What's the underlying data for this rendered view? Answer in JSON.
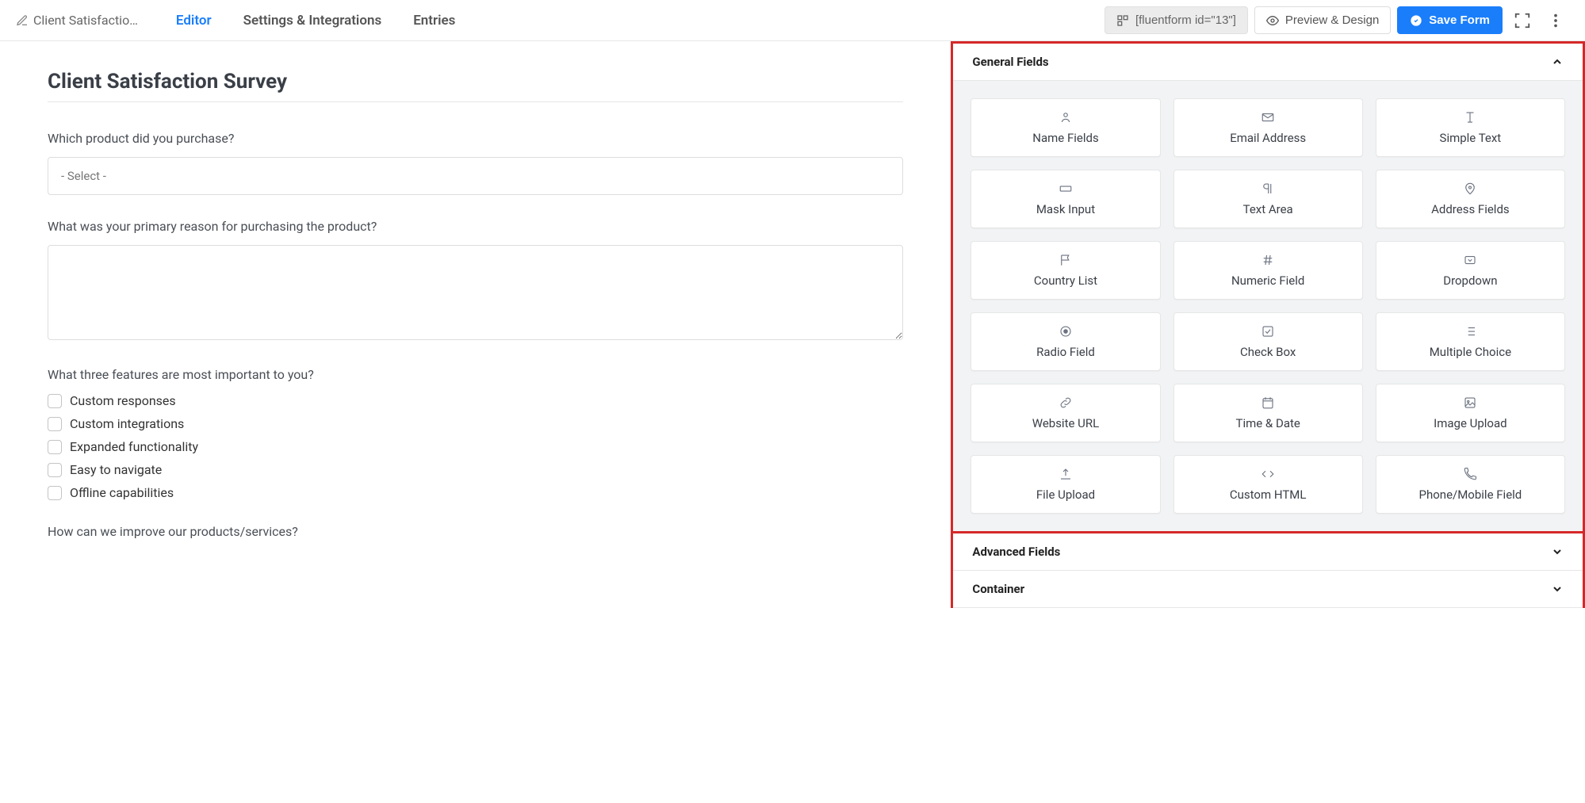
{
  "header": {
    "form_name": "Client Satisfactio…",
    "tabs": {
      "editor": "Editor",
      "settings": "Settings & Integrations",
      "entries": "Entries"
    },
    "shortcode": "[fluentform id=\"13\"]",
    "preview_label": "Preview & Design",
    "save_label": "Save Form"
  },
  "form": {
    "title": "Client Satisfaction Survey",
    "q1_label": "Which product did you purchase?",
    "q1_placeholder": "- Select -",
    "q2_label": "What was your primary reason for purchasing the product?",
    "q3_label": "What three features are most important to you?",
    "q3_options": [
      "Custom responses",
      "Custom integrations",
      "Expanded functionality",
      "Easy to navigate",
      "Offline capabilities"
    ],
    "q4_label": "How can we improve our products/services?"
  },
  "panels": {
    "general_title": "General Fields",
    "advanced_title": "Advanced Fields",
    "container_title": "Container",
    "general_fields": [
      "Name Fields",
      "Email Address",
      "Simple Text",
      "Mask Input",
      "Text Area",
      "Address Fields",
      "Country List",
      "Numeric Field",
      "Dropdown",
      "Radio Field",
      "Check Box",
      "Multiple Choice",
      "Website URL",
      "Time & Date",
      "Image Upload",
      "File Upload",
      "Custom HTML",
      "Phone/Mobile Field"
    ]
  }
}
